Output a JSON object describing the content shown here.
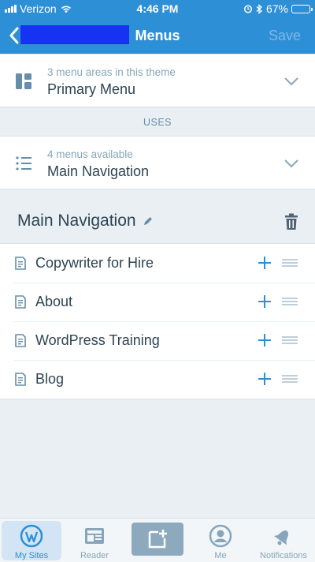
{
  "status_bar": {
    "carrier": "Verizon",
    "time": "4:46 PM",
    "battery": "67%",
    "battery_level": 0.67
  },
  "nav": {
    "title": "Menus",
    "save_label": "Save"
  },
  "menu_area": {
    "sub": "3 menu areas in this theme",
    "main": "Primary Menu"
  },
  "uses_label": "USES",
  "menus": {
    "sub": "4 menus available",
    "main": "Main Navigation"
  },
  "menu_heading": "Main Navigation",
  "items": [
    {
      "label": "Copywriter for Hire"
    },
    {
      "label": "About"
    },
    {
      "label": "WordPress Training"
    },
    {
      "label": "Blog"
    }
  ],
  "tabs": [
    {
      "label": "My Sites",
      "icon": "wordpress-icon"
    },
    {
      "label": "Reader",
      "icon": "reader-icon"
    },
    {
      "label": "",
      "icon": "write-icon"
    },
    {
      "label": "Me",
      "icon": "me-icon"
    },
    {
      "label": "Notifications",
      "icon": "bell-icon"
    }
  ],
  "colors": {
    "brand": "#2d8fd5",
    "redacted_block": "#1632f2",
    "text": "#2e4453",
    "muted": "#87a6bc"
  }
}
